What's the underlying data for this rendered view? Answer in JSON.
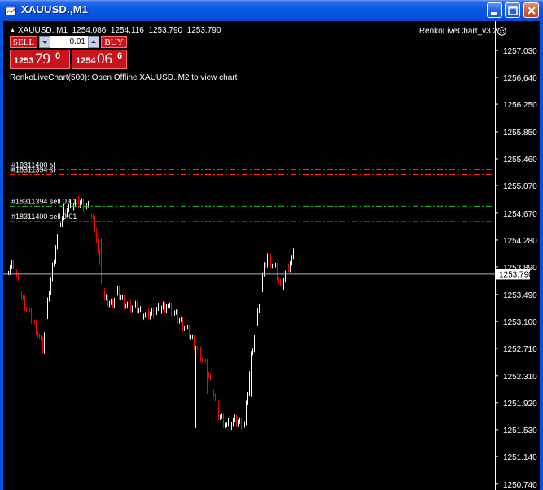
{
  "window": {
    "title": "XAUUSD.,M1",
    "icon": "chart-window-icon"
  },
  "chart": {
    "symbol_line": "XAUUSD.,M1  1254.086  1254.116  1253.790  1253.790",
    "indicator": "RenkoLiveChart_v3.2",
    "message": "RenkoLiveChart(500): Open Offline XAUUSD.,M2 to view chart",
    "current_price_label": "1253.790",
    "current_price": 1253.79,
    "price_scale": [
      "1257.030",
      "1256.640",
      "1256.250",
      "1255.850",
      "1255.460",
      "1255.070",
      "1254.670",
      "1254.280",
      "1253.890",
      "1253.490",
      "1253.100",
      "1252.710",
      "1252.310",
      "1251.920",
      "1251.530",
      "1251.140",
      "1250.740"
    ],
    "orders": [
      {
        "label": "#18311400 sl",
        "price": 1255.3,
        "color": "#ff2020"
      },
      {
        "label": "#18311394 sl",
        "price": 1255.23,
        "color": "#ff2020"
      },
      {
        "label": "#18311394 sell 0.01",
        "price": 1254.77,
        "color": "#20c020"
      },
      {
        "label": "#18311400 sell 0.01",
        "price": 1254.55,
        "color": "#20c020"
      }
    ],
    "colors": {
      "background": "#000000",
      "bull_bar": "#ffffff",
      "bear_bar": "#ff0000",
      "grid_text": "#ffffff",
      "bid_line": "#b0b0d0"
    }
  },
  "trade_panel": {
    "sell_label": "SELL",
    "buy_label": "BUY",
    "lot_value": "0.01",
    "bid": {
      "main": "1253",
      "big": "79",
      "sup": "0"
    },
    "ask": {
      "main": "1254",
      "big": "06",
      "sup": "6"
    }
  }
}
